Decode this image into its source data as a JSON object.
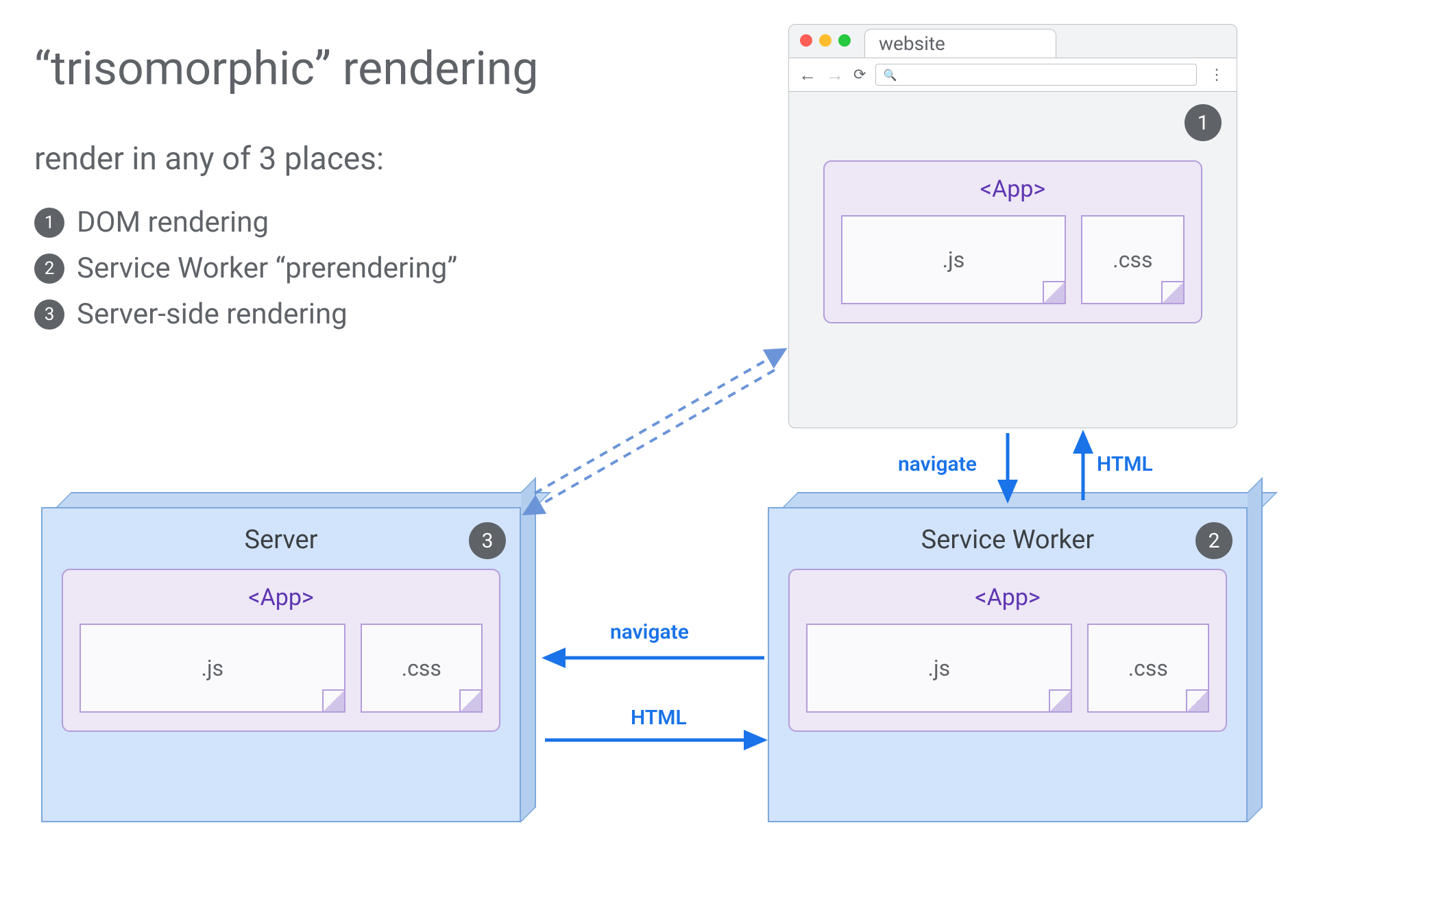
{
  "title": "“trisomorphic” rendering",
  "subtitle": "render in any of 3 places:",
  "list": [
    {
      "num": "1",
      "text": "DOM rendering"
    },
    {
      "num": "2",
      "text": "Service Worker “prerendering”"
    },
    {
      "num": "3",
      "text": "Server-side rendering"
    }
  ],
  "browser": {
    "tab_label": "website",
    "badge": "1",
    "app": {
      "title": "<App>",
      "js": ".js",
      "css": ".css"
    }
  },
  "server_panel": {
    "title": "Server",
    "badge": "3",
    "app": {
      "title": "<App>",
      "js": ".js",
      "css": ".css"
    }
  },
  "sw_panel": {
    "title": "Service Worker",
    "badge": "2",
    "app": {
      "title": "<App>",
      "js": ".js",
      "css": ".css"
    }
  },
  "arrows": {
    "browser_to_sw": "navigate",
    "sw_to_browser": "HTML",
    "sw_to_server": "navigate",
    "server_to_sw": "HTML"
  }
}
